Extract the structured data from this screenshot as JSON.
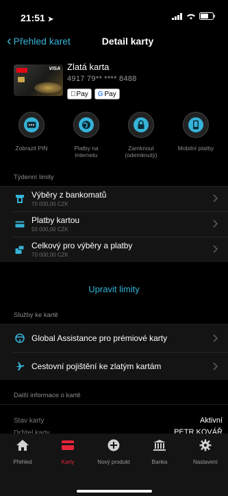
{
  "status": {
    "time": "21:51"
  },
  "nav": {
    "back_label": "Přehled karet",
    "title": "Detail karty"
  },
  "card": {
    "name": "Zlatá karta",
    "number": "4917 79** **** 8488",
    "apple_pay": "Pay",
    "google_pay_g": "G",
    "google_pay": "Pay",
    "thumb_brand": "VISA",
    "thumb_bank": "KB"
  },
  "actions": [
    {
      "label": "Zobrazit PIN",
      "icon": "pin-dots-icon"
    },
    {
      "label": "Platby na internetu",
      "icon": "globe-icon"
    },
    {
      "label": "Zamknout (odemknutý)",
      "icon": "lock-icon"
    },
    {
      "label": "Mobilní platby",
      "icon": "phone-icon"
    }
  ],
  "limits": {
    "header": "Týdenní limity",
    "items": [
      {
        "title": "Výběry z bankomatů",
        "amount": "70 000,00 CZK",
        "icon": "atm-icon"
      },
      {
        "title": "Platby kartou",
        "amount": "50 000,00 CZK",
        "icon": "card-icon"
      },
      {
        "title": "Celkový pro výběry a platby",
        "amount": "70 000,00 CZK",
        "icon": "combined-icon"
      }
    ],
    "edit_label": "Upravit limity"
  },
  "services": {
    "header": "Služby ke kartě",
    "items": [
      {
        "label": "Global Assistance pro prémiové karty",
        "icon": "steering-wheel-icon"
      },
      {
        "label": "Cestovní pojištění ke zlatým kartám",
        "icon": "airplane-icon"
      }
    ]
  },
  "info": {
    "header": "Další informace o kartě",
    "rows": [
      {
        "label": "Stav karty",
        "value": "Aktivní"
      },
      {
        "label": "Držitel karty",
        "value": "PETR KOVÁŘ"
      }
    ]
  },
  "tabs": [
    {
      "label": "Přehled",
      "icon": "home-icon",
      "active": false
    },
    {
      "label": "Karty",
      "icon": "card-icon",
      "active": true
    },
    {
      "label": "Nový produkt",
      "icon": "plus-icon",
      "active": false
    },
    {
      "label": "Banka",
      "icon": "bank-icon",
      "active": false
    },
    {
      "label": "Nastavení",
      "icon": "gear-icon",
      "active": false
    }
  ],
  "colors": {
    "accent": "#36b3d8",
    "active_tab": "#e5243a",
    "background": "#000000",
    "panel": "#141414"
  }
}
